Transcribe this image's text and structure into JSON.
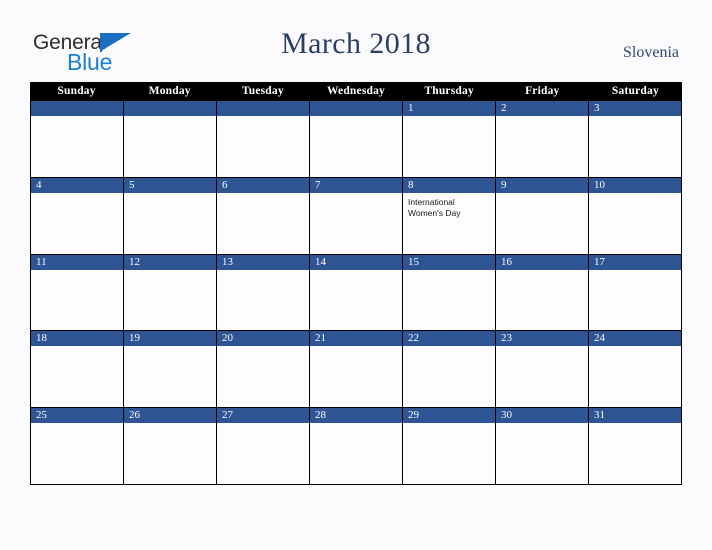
{
  "branding": {
    "logo_text_top": "General",
    "logo_text_bottom": "Blue",
    "logo_icon": "blue-triangle-icon",
    "color_dark": "#2e2e2e",
    "color_blue": "#1b7fd4"
  },
  "header": {
    "title": "March 2018",
    "region": "Slovenia",
    "title_color": "#2b3f66",
    "region_color": "#32496f"
  },
  "calendar": {
    "header_bg": "#000000",
    "day_bar_bg": "#2e5494",
    "cell_bg": "#fdfdff",
    "weekdays": [
      "Sunday",
      "Monday",
      "Tuesday",
      "Wednesday",
      "Thursday",
      "Friday",
      "Saturday"
    ],
    "weeks": [
      [
        {
          "num": "",
          "event": ""
        },
        {
          "num": "",
          "event": ""
        },
        {
          "num": "",
          "event": ""
        },
        {
          "num": "",
          "event": ""
        },
        {
          "num": "1",
          "event": ""
        },
        {
          "num": "2",
          "event": ""
        },
        {
          "num": "3",
          "event": ""
        }
      ],
      [
        {
          "num": "4",
          "event": ""
        },
        {
          "num": "5",
          "event": ""
        },
        {
          "num": "6",
          "event": ""
        },
        {
          "num": "7",
          "event": ""
        },
        {
          "num": "8",
          "event": "International Women's Day"
        },
        {
          "num": "9",
          "event": ""
        },
        {
          "num": "10",
          "event": ""
        }
      ],
      [
        {
          "num": "11",
          "event": ""
        },
        {
          "num": "12",
          "event": ""
        },
        {
          "num": "13",
          "event": ""
        },
        {
          "num": "14",
          "event": ""
        },
        {
          "num": "15",
          "event": ""
        },
        {
          "num": "16",
          "event": ""
        },
        {
          "num": "17",
          "event": ""
        }
      ],
      [
        {
          "num": "18",
          "event": ""
        },
        {
          "num": "19",
          "event": ""
        },
        {
          "num": "20",
          "event": ""
        },
        {
          "num": "21",
          "event": ""
        },
        {
          "num": "22",
          "event": ""
        },
        {
          "num": "23",
          "event": ""
        },
        {
          "num": "24",
          "event": ""
        }
      ],
      [
        {
          "num": "25",
          "event": ""
        },
        {
          "num": "26",
          "event": ""
        },
        {
          "num": "27",
          "event": ""
        },
        {
          "num": "28",
          "event": ""
        },
        {
          "num": "29",
          "event": ""
        },
        {
          "num": "30",
          "event": ""
        },
        {
          "num": "31",
          "event": ""
        }
      ]
    ]
  }
}
